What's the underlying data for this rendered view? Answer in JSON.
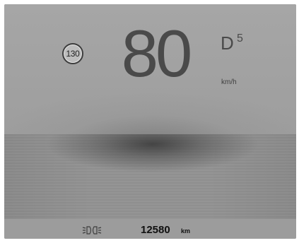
{
  "cluster": {
    "speed_limit": "130",
    "speed": "80",
    "speed_unit": "km/h",
    "gear": "D",
    "gear_number": "5",
    "odometer": "12580",
    "odometer_unit": "km",
    "lighting_icon": "low-beam-headlight-icon"
  },
  "colors": {
    "background": "#a3a3a3",
    "road_dark": "#4a4a4a",
    "text_primary": "#4a4a4a",
    "odometer_text": "#111111"
  }
}
